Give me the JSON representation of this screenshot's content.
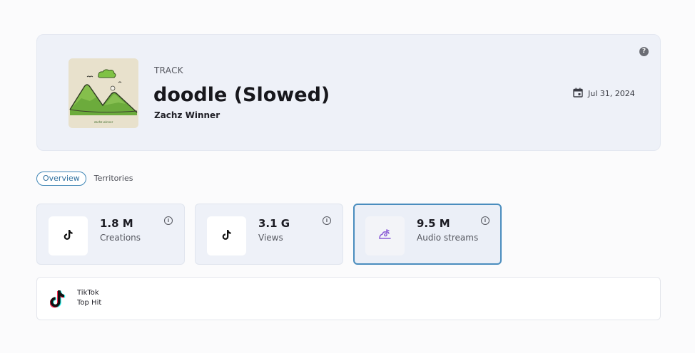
{
  "track": {
    "type_label": "TRACK",
    "title": "doodle (Slowed)",
    "artist": "Zachz Winner",
    "release_date": "Jul 31, 2024",
    "cover_signature": "zachz winner"
  },
  "tabs": [
    {
      "label": "Overview",
      "active": true
    },
    {
      "label": "Territories",
      "active": false
    }
  ],
  "stats": [
    {
      "value": "1.8 M",
      "label": "Creations",
      "icon": "tiktok-icon",
      "selected": false
    },
    {
      "value": "3.1 G",
      "label": "Views",
      "icon": "tiktok-icon",
      "selected": false
    },
    {
      "value": "9.5 M",
      "label": "Audio streams",
      "icon": "audio-stream-icon",
      "selected": true
    }
  ],
  "hit": {
    "platform": "TikTok",
    "label": "Top Hit",
    "icon": "tiktok-logo-icon"
  },
  "colors": {
    "accent": "#4a8dbe",
    "card_bg": "#eef1f8",
    "audio_icon": "#8a5cd6"
  }
}
